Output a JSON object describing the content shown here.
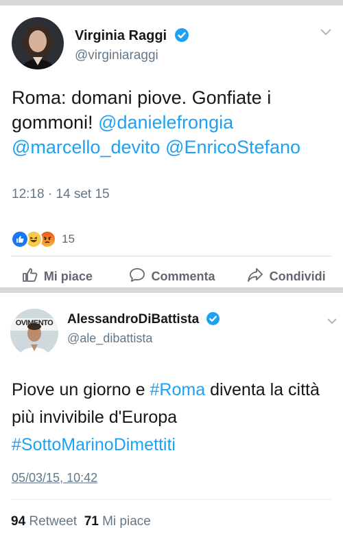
{
  "post1": {
    "name": "Virginia Raggi",
    "handle": "@virginiaraggi",
    "text_plain": "Roma: domani piove. Gonfiate i gommoni!",
    "mentions": [
      "@danielefrongia",
      "@marcello_devito",
      "@EnricoStefano"
    ],
    "timestamp": "12:18 · 14 set 15",
    "reaction_count": "15",
    "actions": {
      "like": "Mi piace",
      "comment": "Commenta",
      "share": "Condividi"
    }
  },
  "post2": {
    "name": "AlessandroDiBattista",
    "handle": "@ale_dibattista",
    "text_part1": "Piove un giorno e ",
    "hashtag1": "#Roma",
    "text_part2": " diventa la città più invivibile d'Europa",
    "hashtag2": "#SottoMarinoDimettiti",
    "timestamp": "05/03/15, 10:42",
    "retweet_count": "94",
    "retweet_label": "Retweet",
    "like_count": "71",
    "like_label": "Mi piace",
    "avatar_banner_text": "OVIMENTO"
  },
  "colors": {
    "link": "#1da1f2",
    "verified": "#1da1f2",
    "secondary_text": "#657786",
    "separator": "#d6d9dc"
  },
  "icons": [
    "verified-badge-icon",
    "chevron-down-icon",
    "like-reaction-icon",
    "haha-reaction-icon",
    "angry-reaction-icon",
    "thumbs-up-icon",
    "comment-icon",
    "share-icon"
  ]
}
